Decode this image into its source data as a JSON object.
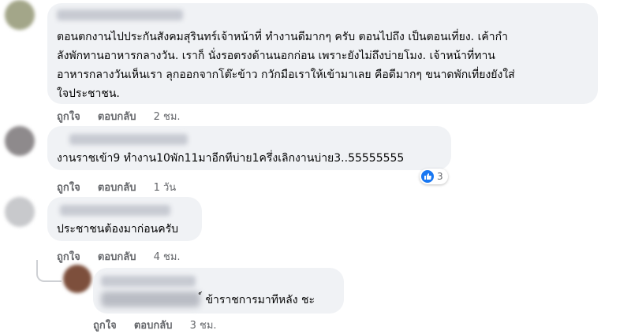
{
  "comments": [
    {
      "lines": [
        "ตอนตกงานไปประกันสังคมสุรินทร์เจ้าหน้าที่ ทำงานดีมากๆ ครับ ตอนไปถึง เป็นตอนเที่ยง. เค้ากำ",
        "ลังพักทานอาหารกลางวัน. เราก็ นั่งรอตรงด้านนอกก่อน เพราะยังไม่ถึงบ่ายโมง. เจ้าหน้าที่ทาน",
        "อาหารกลางวันเห็นเรา ลุกออกจากโต๊ะข้าว กวักมือเราให้เข้ามาเลย คือดีมากๆ ขนาดพักเที่ยงยังใส่",
        "ใจประชาชน."
      ],
      "like_label": "ถูกใจ",
      "reply_label": "ตอบกลับ",
      "time": "2 ชม."
    },
    {
      "lines": [
        "งานราชเข้า9 ทำงาน10พัก11มาอีกทีบ่าย1ครึ่งเลิกงานบ่าย3..55555555"
      ],
      "like_label": "ถูกใจ",
      "reply_label": "ตอบกลับ",
      "time": "1 วัน",
      "reaction_count": "3"
    },
    {
      "lines": [
        "ประชาชนต้องมาก่อนครับ"
      ],
      "like_label": "ถูกใจ",
      "reply_label": "ตอบกลับ",
      "time": "4 ชม."
    },
    {
      "lines": [
        "์ ข้าราชการมาทีหลัง ชะ"
      ],
      "like_label": "ถูกใจ",
      "reply_label": "ตอบกลับ",
      "time": "3 ชม."
    }
  ],
  "icons": {
    "reaction": "like-icon"
  },
  "colors": {
    "bubble": "#f0f2f5",
    "like_blue": "#1877f2",
    "meta_gray": "#65676b"
  }
}
